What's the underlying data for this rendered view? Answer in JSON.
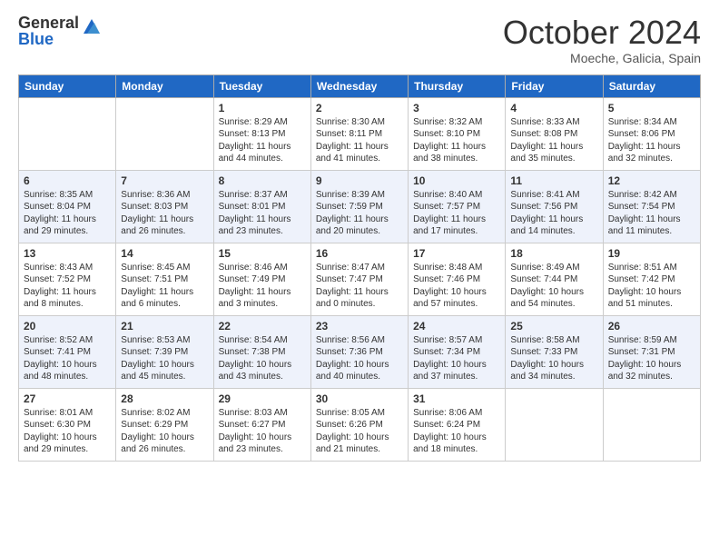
{
  "logo": {
    "general": "General",
    "blue": "Blue"
  },
  "header": {
    "month": "October 2024",
    "location": "Moeche, Galicia, Spain"
  },
  "days_of_week": [
    "Sunday",
    "Monday",
    "Tuesday",
    "Wednesday",
    "Thursday",
    "Friday",
    "Saturday"
  ],
  "weeks": [
    [
      {
        "day": "",
        "info": ""
      },
      {
        "day": "",
        "info": ""
      },
      {
        "day": "1",
        "info": "Sunrise: 8:29 AM\nSunset: 8:13 PM\nDaylight: 11 hours and 44 minutes."
      },
      {
        "day": "2",
        "info": "Sunrise: 8:30 AM\nSunset: 8:11 PM\nDaylight: 11 hours and 41 minutes."
      },
      {
        "day": "3",
        "info": "Sunrise: 8:32 AM\nSunset: 8:10 PM\nDaylight: 11 hours and 38 minutes."
      },
      {
        "day": "4",
        "info": "Sunrise: 8:33 AM\nSunset: 8:08 PM\nDaylight: 11 hours and 35 minutes."
      },
      {
        "day": "5",
        "info": "Sunrise: 8:34 AM\nSunset: 8:06 PM\nDaylight: 11 hours and 32 minutes."
      }
    ],
    [
      {
        "day": "6",
        "info": "Sunrise: 8:35 AM\nSunset: 8:04 PM\nDaylight: 11 hours and 29 minutes."
      },
      {
        "day": "7",
        "info": "Sunrise: 8:36 AM\nSunset: 8:03 PM\nDaylight: 11 hours and 26 minutes."
      },
      {
        "day": "8",
        "info": "Sunrise: 8:37 AM\nSunset: 8:01 PM\nDaylight: 11 hours and 23 minutes."
      },
      {
        "day": "9",
        "info": "Sunrise: 8:39 AM\nSunset: 7:59 PM\nDaylight: 11 hours and 20 minutes."
      },
      {
        "day": "10",
        "info": "Sunrise: 8:40 AM\nSunset: 7:57 PM\nDaylight: 11 hours and 17 minutes."
      },
      {
        "day": "11",
        "info": "Sunrise: 8:41 AM\nSunset: 7:56 PM\nDaylight: 11 hours and 14 minutes."
      },
      {
        "day": "12",
        "info": "Sunrise: 8:42 AM\nSunset: 7:54 PM\nDaylight: 11 hours and 11 minutes."
      }
    ],
    [
      {
        "day": "13",
        "info": "Sunrise: 8:43 AM\nSunset: 7:52 PM\nDaylight: 11 hours and 8 minutes."
      },
      {
        "day": "14",
        "info": "Sunrise: 8:45 AM\nSunset: 7:51 PM\nDaylight: 11 hours and 6 minutes."
      },
      {
        "day": "15",
        "info": "Sunrise: 8:46 AM\nSunset: 7:49 PM\nDaylight: 11 hours and 3 minutes."
      },
      {
        "day": "16",
        "info": "Sunrise: 8:47 AM\nSunset: 7:47 PM\nDaylight: 11 hours and 0 minutes."
      },
      {
        "day": "17",
        "info": "Sunrise: 8:48 AM\nSunset: 7:46 PM\nDaylight: 10 hours and 57 minutes."
      },
      {
        "day": "18",
        "info": "Sunrise: 8:49 AM\nSunset: 7:44 PM\nDaylight: 10 hours and 54 minutes."
      },
      {
        "day": "19",
        "info": "Sunrise: 8:51 AM\nSunset: 7:42 PM\nDaylight: 10 hours and 51 minutes."
      }
    ],
    [
      {
        "day": "20",
        "info": "Sunrise: 8:52 AM\nSunset: 7:41 PM\nDaylight: 10 hours and 48 minutes."
      },
      {
        "day": "21",
        "info": "Sunrise: 8:53 AM\nSunset: 7:39 PM\nDaylight: 10 hours and 45 minutes."
      },
      {
        "day": "22",
        "info": "Sunrise: 8:54 AM\nSunset: 7:38 PM\nDaylight: 10 hours and 43 minutes."
      },
      {
        "day": "23",
        "info": "Sunrise: 8:56 AM\nSunset: 7:36 PM\nDaylight: 10 hours and 40 minutes."
      },
      {
        "day": "24",
        "info": "Sunrise: 8:57 AM\nSunset: 7:34 PM\nDaylight: 10 hours and 37 minutes."
      },
      {
        "day": "25",
        "info": "Sunrise: 8:58 AM\nSunset: 7:33 PM\nDaylight: 10 hours and 34 minutes."
      },
      {
        "day": "26",
        "info": "Sunrise: 8:59 AM\nSunset: 7:31 PM\nDaylight: 10 hours and 32 minutes."
      }
    ],
    [
      {
        "day": "27",
        "info": "Sunrise: 8:01 AM\nSunset: 6:30 PM\nDaylight: 10 hours and 29 minutes."
      },
      {
        "day": "28",
        "info": "Sunrise: 8:02 AM\nSunset: 6:29 PM\nDaylight: 10 hours and 26 minutes."
      },
      {
        "day": "29",
        "info": "Sunrise: 8:03 AM\nSunset: 6:27 PM\nDaylight: 10 hours and 23 minutes."
      },
      {
        "day": "30",
        "info": "Sunrise: 8:05 AM\nSunset: 6:26 PM\nDaylight: 10 hours and 21 minutes."
      },
      {
        "day": "31",
        "info": "Sunrise: 8:06 AM\nSunset: 6:24 PM\nDaylight: 10 hours and 18 minutes."
      },
      {
        "day": "",
        "info": ""
      },
      {
        "day": "",
        "info": ""
      }
    ]
  ]
}
